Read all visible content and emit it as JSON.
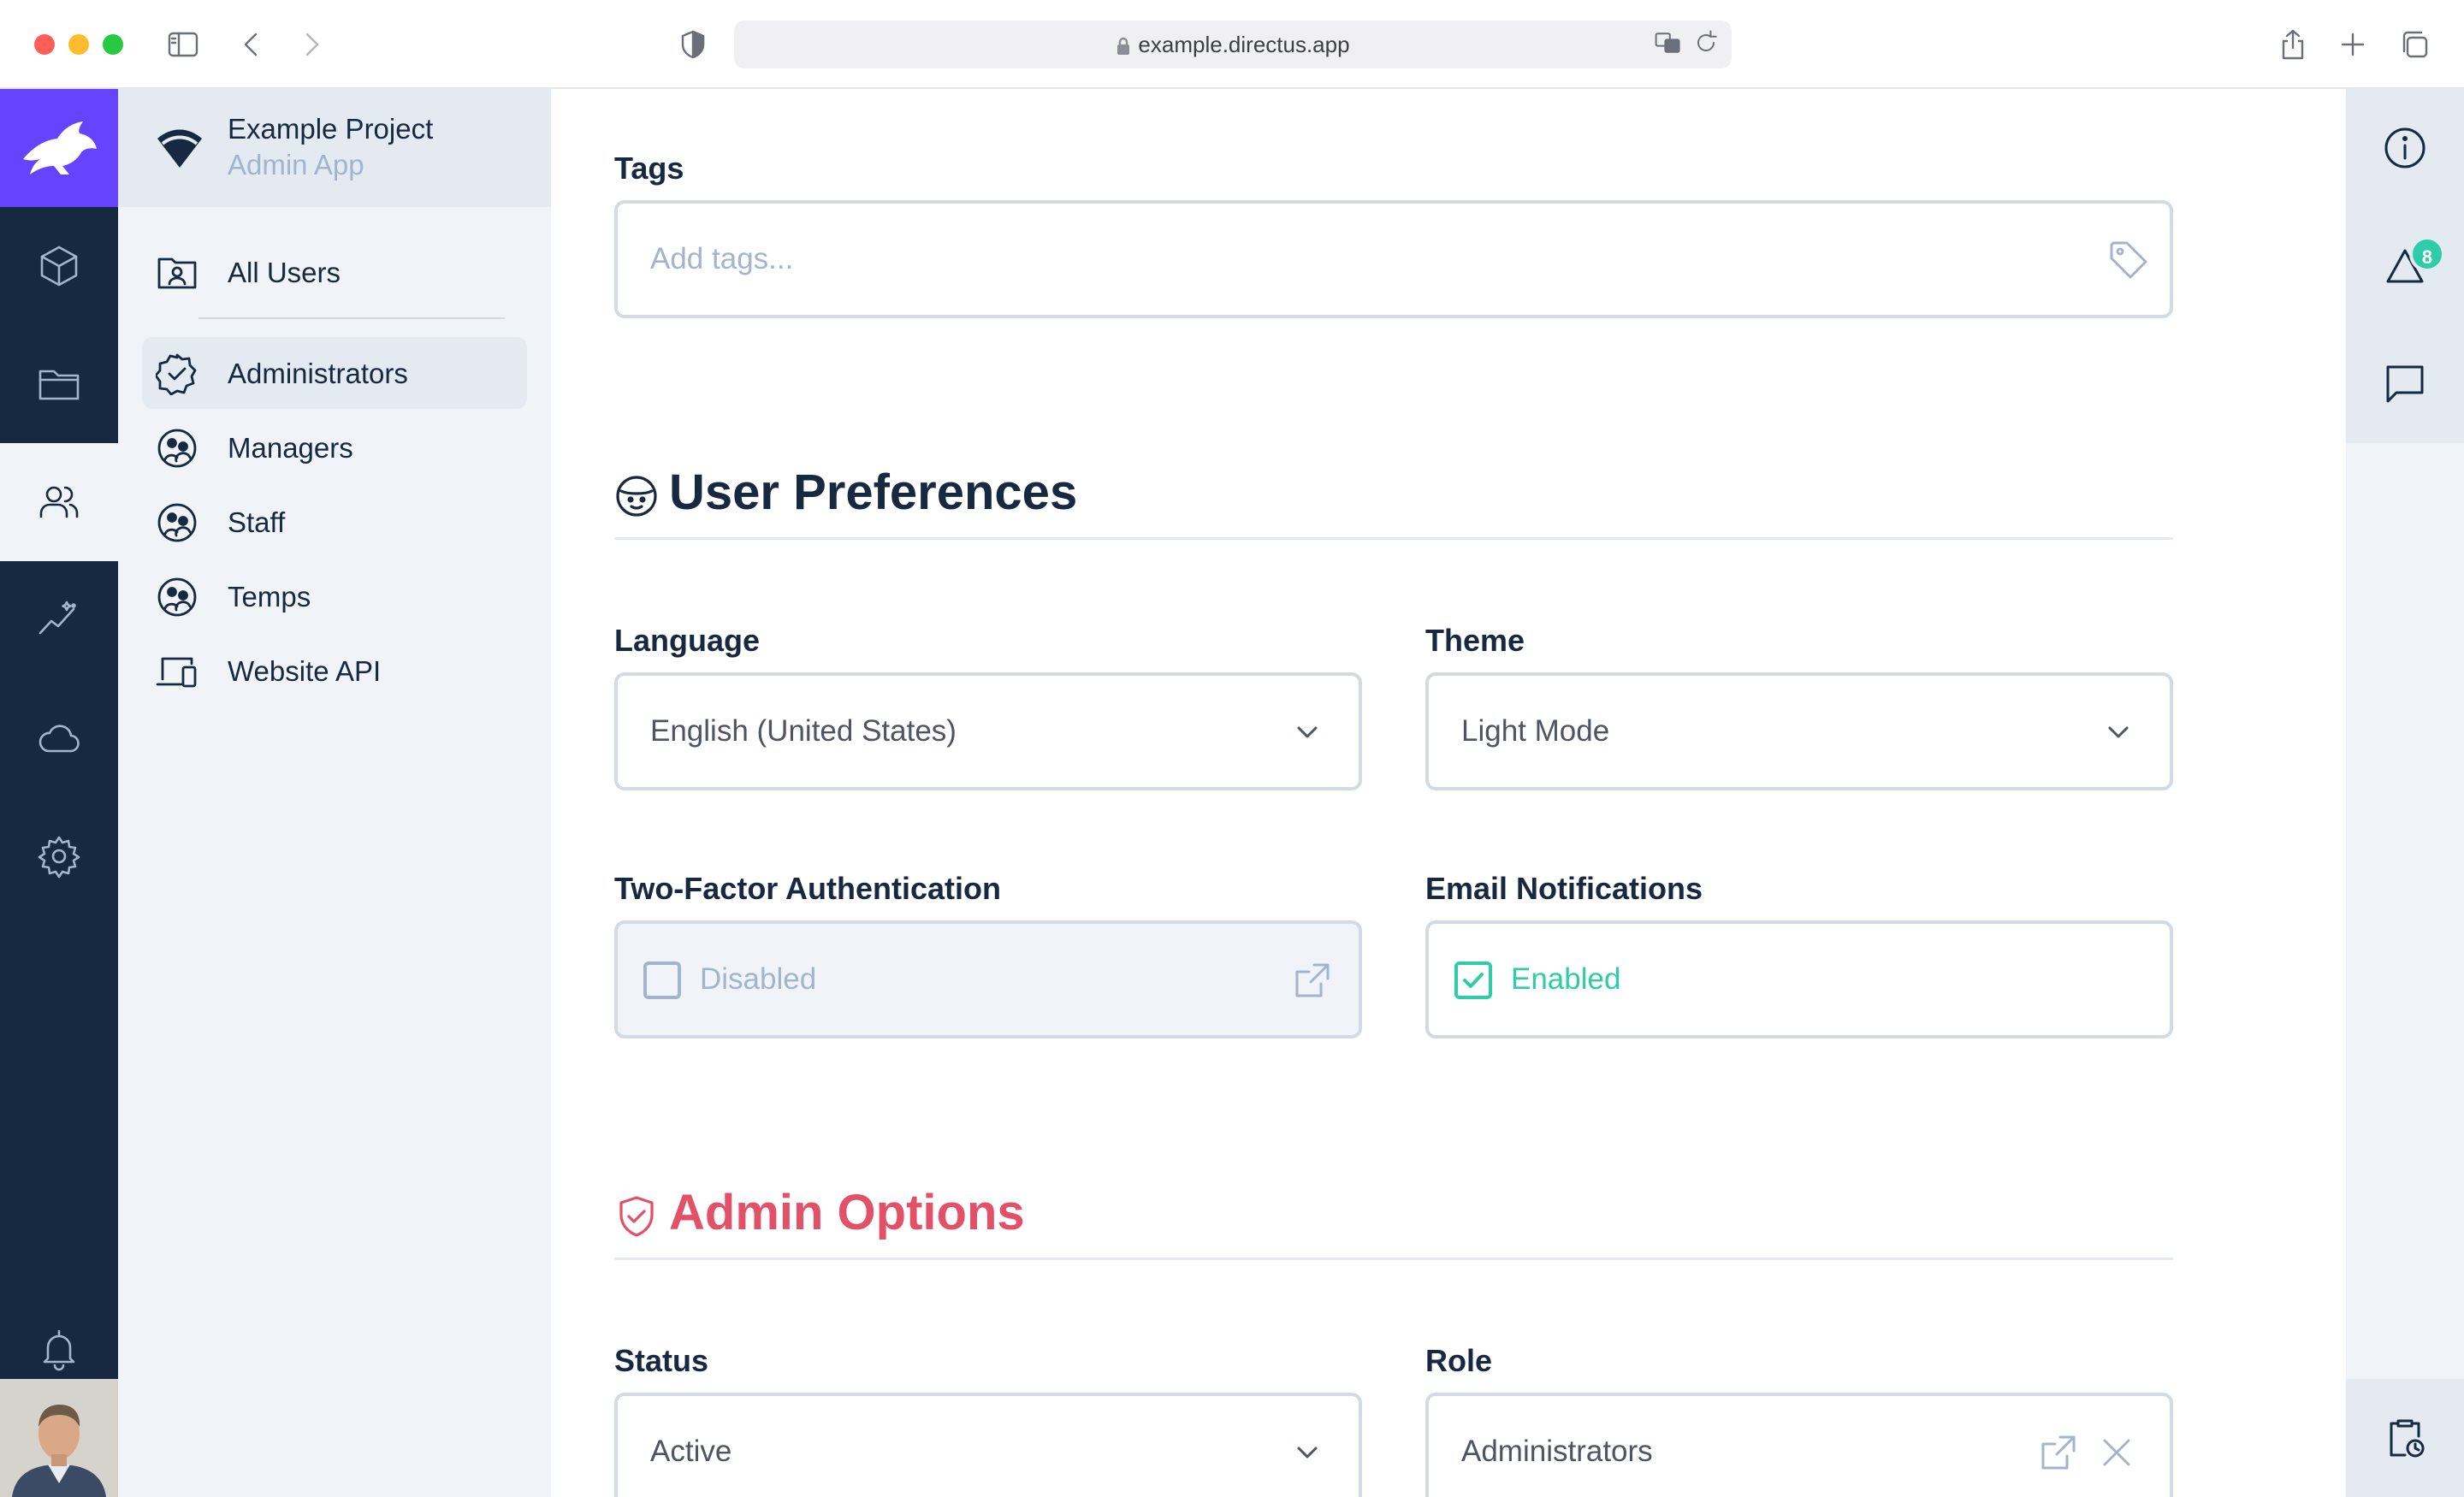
{
  "browser": {
    "url": "example.directus.app"
  },
  "project": {
    "name": "Example Project",
    "subtitle": "Admin App"
  },
  "nav": {
    "items": [
      {
        "label": "All Users",
        "icon": "folder-user-icon"
      },
      {
        "label": "Administrators",
        "icon": "verified-badge-icon",
        "active": true
      },
      {
        "label": "Managers",
        "icon": "face-group-icon"
      },
      {
        "label": "Staff",
        "icon": "face-group-icon"
      },
      {
        "label": "Temps",
        "icon": "face-group-icon"
      },
      {
        "label": "Website API",
        "icon": "devices-icon"
      }
    ]
  },
  "modules": [
    "box-icon",
    "folder-icon",
    "users-icon",
    "insights-icon",
    "cloud-icon",
    "settings-icon",
    "bell-icon"
  ],
  "form": {
    "tags": {
      "label": "Tags",
      "placeholder": "Add tags..."
    },
    "user_preferences": {
      "title": "User Preferences"
    },
    "language": {
      "label": "Language",
      "value": "English (United States)"
    },
    "theme": {
      "label": "Theme",
      "value": "Light Mode"
    },
    "two_factor": {
      "label": "Two-Factor Authentication",
      "value": "Disabled"
    },
    "email_notifications": {
      "label": "Email Notifications",
      "value": "Enabled"
    },
    "admin_options": {
      "title": "Admin Options"
    },
    "status": {
      "label": "Status",
      "value": "Active"
    },
    "role": {
      "label": "Role",
      "value": "Administrators"
    }
  },
  "sidebar_right": {
    "activity_count": "8"
  },
  "colors": {
    "primary": "#6644ff",
    "dark": "#172940",
    "danger": "#e35169",
    "success": "#2ecda7",
    "border": "#d3dae4"
  }
}
